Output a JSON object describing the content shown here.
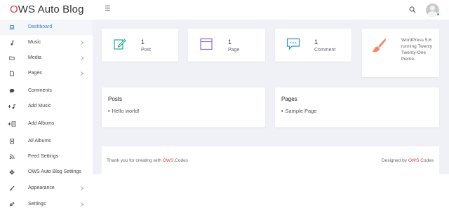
{
  "header": {
    "brand_first": "O",
    "brand_rest": "WS Auto Blog"
  },
  "sidebar": {
    "items": [
      {
        "label": "Dashboard",
        "icon": "laptop-icon",
        "active": true
      },
      {
        "label": "Music",
        "icon": "music-note-icon",
        "has_submenu": true
      },
      {
        "label": "Media",
        "icon": "folder-icon",
        "has_submenu": true
      },
      {
        "label": "Pages",
        "icon": "page-icon",
        "has_submenu": true
      },
      {
        "label": "Comments",
        "icon": "comment-icon"
      },
      {
        "label": "Add Music",
        "icon": "add-music-icon"
      },
      {
        "label": "Add Albums",
        "icon": "add-album-icon"
      },
      {
        "label": "All Albums",
        "icon": "albums-icon"
      },
      {
        "label": "Feed Settings",
        "icon": "rss-icon"
      },
      {
        "label": "OWS Auto Blog Settings",
        "icon": "gear-icon"
      },
      {
        "label": "Appearance",
        "icon": "brush-icon",
        "has_submenu": true
      },
      {
        "label": "Settings",
        "icon": "settings-icon",
        "has_submenu": true
      }
    ]
  },
  "stats": {
    "post": {
      "count": "1",
      "label": "Post"
    },
    "page": {
      "count": "1",
      "label": "Page"
    },
    "comment": {
      "count": "1",
      "label": "Comment"
    },
    "theme": {
      "text": "WordPress 5.6 running Twenty Twenty-One theme."
    }
  },
  "posts_panel": {
    "title": "Posts",
    "items": [
      "Hello world!"
    ]
  },
  "pages_panel": {
    "title": "Pages",
    "items": [
      "Sample Page"
    ]
  },
  "footer": {
    "left_text": "Thank you for creating with ",
    "left_brand_ows": "OWS",
    "left_brand_rest": ".Codes",
    "right_text": "Designed by ",
    "right_brand_ows": "OWS",
    "right_brand_rest": ".Codes"
  },
  "colors": {
    "accent": "#e53935",
    "active_nav": "#3b82c4",
    "post_icon": "#26a69a",
    "page_icon": "#8e6ad8",
    "comment_icon": "#2f8fd8",
    "brush_icon": "#f08a6e",
    "online": "#3cc13b"
  }
}
